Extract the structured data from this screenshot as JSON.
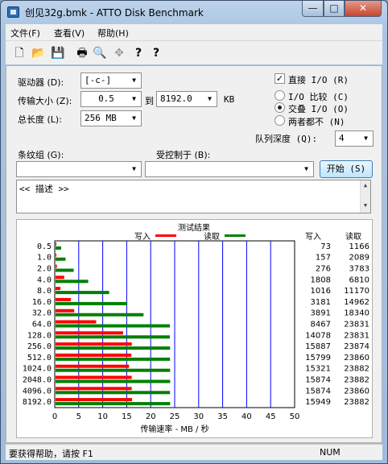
{
  "window": {
    "title": "创见32g.bmk - ATTO Disk Benchmark",
    "controls": {
      "minimize": "—",
      "maximize": "□",
      "close": "✕"
    }
  },
  "menu": [
    "文件(F)",
    "查看(V)",
    "帮助(H)"
  ],
  "toolbar": {
    "icons": [
      "new-file-icon",
      "open-folder-icon",
      "save-icon",
      "print-icon",
      "print-preview-icon",
      "move-icon",
      "help-icon",
      "context-help-icon"
    ],
    "glyphs": [
      "🗋",
      "📂",
      "💾",
      "🖶",
      "🔍",
      "✥",
      "?",
      "?"
    ]
  },
  "settings": {
    "drive_label": "驱动器 (D):",
    "drive_value": "[-c-]",
    "transfer_label": "传输大小 (Z):",
    "transfer_from": "0.5",
    "transfer_to_label": "到",
    "transfer_to": "8192.0",
    "transfer_unit": "KB",
    "total_label": "总长度 (L):",
    "total_value": "256 MB",
    "direct_io_label": "直接 I/O (R)",
    "direct_io_checked": true,
    "io_compare_label": "I/O 比较 (C)",
    "overlapped_io_label": "交叠 I/O (O)",
    "neither_label": "两者都不 (N)",
    "queue_label": "队列深度 (Q):",
    "queue_value": "4",
    "stripe_label": "条纹组 (G):",
    "controlled_label": "受控制于 (B):",
    "start_button": "开始 (S)",
    "description": "<< 描述 >>"
  },
  "results": {
    "title": "测试结果",
    "legend_write": "写入",
    "legend_read": "读取",
    "col_write": "写入",
    "col_read": "读取",
    "xlabel": "传输速率 - MB / 秒",
    "x_ticks": [
      "0",
      "5",
      "10",
      "15",
      "20",
      "25",
      "30",
      "35",
      "40",
      "45",
      "50"
    ],
    "colors": {
      "write": "#ff0000",
      "read": "#008000",
      "grid": "#0000ff"
    }
  },
  "chart_data": {
    "type": "bar",
    "orientation": "horizontal",
    "categories": [
      "0.5",
      "1.0",
      "2.0",
      "4.0",
      "8.0",
      "16.0",
      "32.0",
      "64.0",
      "128.0",
      "256.0",
      "512.0",
      "1024.0",
      "2048.0",
      "4096.0",
      "8192.0"
    ],
    "series": [
      {
        "name": "写入",
        "values": [
          73,
          157,
          276,
          1808,
          1016,
          3181,
          3891,
          8467,
          14078,
          15887,
          15799,
          15321,
          15874,
          15874,
          15949
        ]
      },
      {
        "name": "读取",
        "values": [
          1166,
          2089,
          3783,
          6810,
          11170,
          14962,
          18340,
          23831,
          23831,
          23874,
          23860,
          23882,
          23882,
          23860,
          23882
        ]
      }
    ],
    "xlabel": "传输速率 - MB / 秒",
    "xlim": [
      0,
      50
    ],
    "grid": true,
    "legend": "top"
  },
  "statusbar": {
    "help_text": "要获得帮助，请按 F1",
    "num": "NUM"
  }
}
